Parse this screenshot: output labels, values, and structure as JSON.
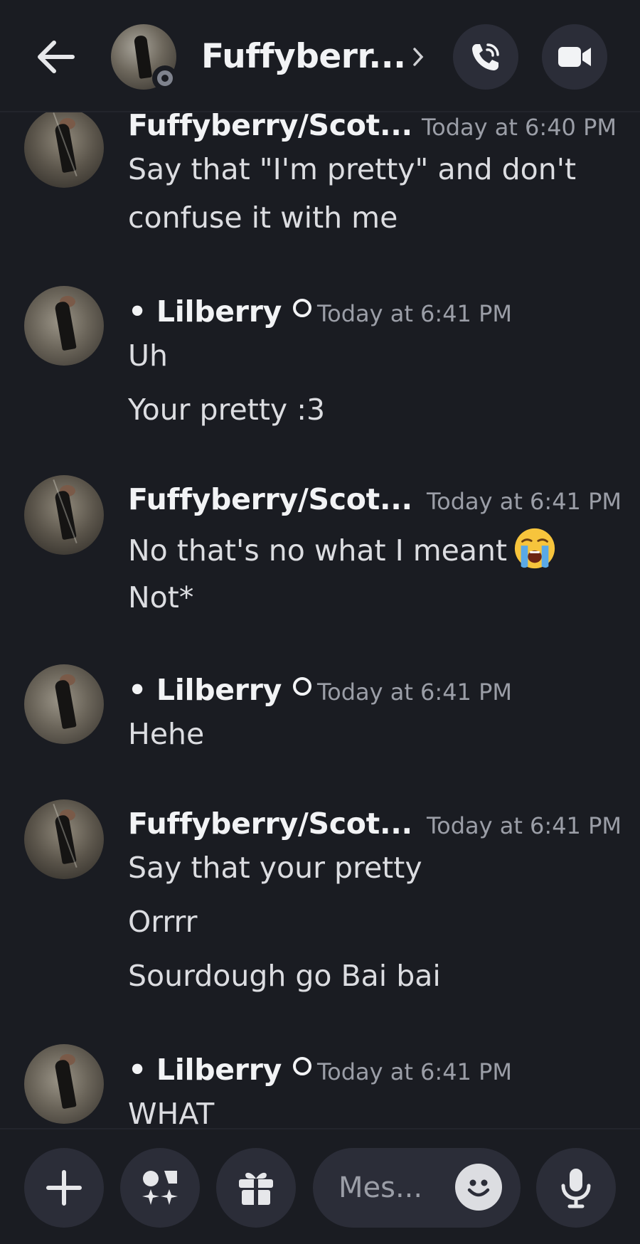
{
  "header": {
    "title": "Fuffyberr...",
    "icons": {
      "back": "arrow-left-icon",
      "chevron": "chevron-right-icon",
      "call": "phone-call-icon",
      "video": "video-camera-icon"
    }
  },
  "messages": [
    {
      "author": "Fuffyberry/Scot...",
      "time": "Today at 6:40 PM",
      "lines": [
        "Say that \"I'm pretty\" and don't",
        "confuse it with me"
      ]
    },
    {
      "author": "• Lilberry",
      "time": "Today at 6:41 PM",
      "lines": [
        "Uh",
        "Your pretty :3"
      ]
    },
    {
      "author": "Fuffyberry/Scot...",
      "time": "Today at 6:41 PM",
      "lines": [
        "No that's no what I meant",
        "Not*"
      ],
      "emoji": "loudly-crying-face"
    },
    {
      "author": "• Lilberry",
      "time": "Today at 6:41 PM",
      "lines": [
        "Hehe"
      ]
    },
    {
      "author": "Fuffyberry/Scot...",
      "time": "Today at 6:41 PM",
      "lines": [
        "Say that your pretty",
        "Orrrr",
        "Sourdough go Bai bai"
      ]
    },
    {
      "author": "• Lilberry",
      "time": "Today at 6:41 PM",
      "lines": [
        "WHAT"
      ]
    }
  ],
  "composer": {
    "placeholder": "Mes...",
    "icons": {
      "plus": "plus-icon",
      "apps": "apps-icon",
      "gift": "gift-icon",
      "emoji": "emoji-smile-icon",
      "mic": "microphone-icon"
    }
  },
  "colors": {
    "background": "#1a1c22",
    "button": "#2b2d38",
    "text": "#dcdde1",
    "muted": "#9b9ea7"
  }
}
